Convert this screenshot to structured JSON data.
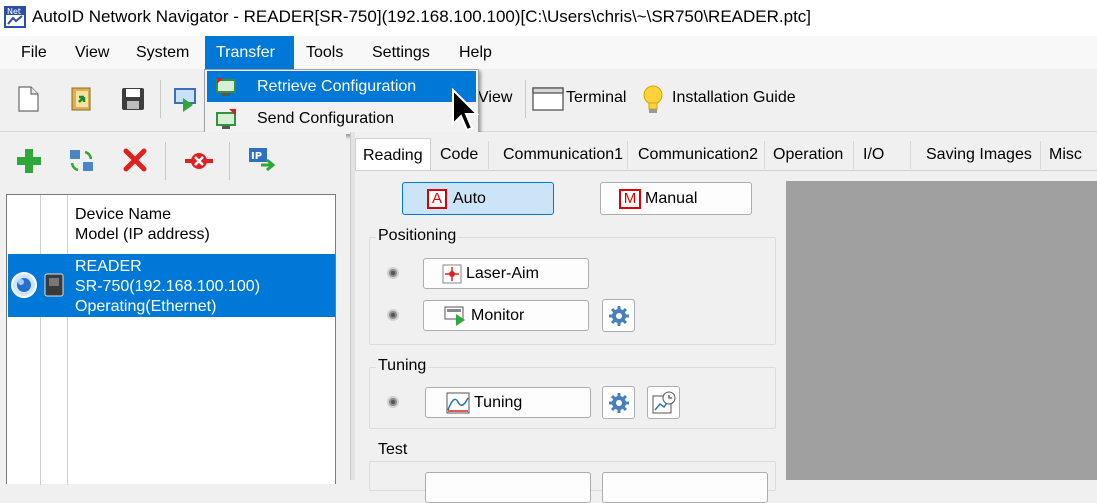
{
  "window": {
    "title": "AutoID Network Navigator - READER[SR-750](192.168.100.100)[C:\\Users\\chris\\~\\SR750\\READER.ptc]",
    "app_icon": "net-app-icon"
  },
  "menubar": {
    "items": [
      {
        "label": "File"
      },
      {
        "label": "View"
      },
      {
        "label": "System"
      },
      {
        "label": "Transfer"
      },
      {
        "label": "Tools"
      },
      {
        "label": "Settings"
      },
      {
        "label": "Help"
      }
    ],
    "active": "Transfer"
  },
  "transfer_menu": {
    "items": [
      {
        "label": "Retrieve Configuration",
        "icon": "retrieve-config-icon",
        "highlighted": true
      },
      {
        "label": "Send Configuration",
        "icon": "send-config-icon",
        "highlighted": false
      }
    ]
  },
  "toolbar": {
    "view_label": "View",
    "terminal_label": "Terminal",
    "installation_guide_label": "Installation Guide",
    "icons": [
      "new-file-icon",
      "open-file-icon",
      "save-icon",
      "monitor-play-icon",
      "view-icon",
      "terminal-icon",
      "lightbulb-icon"
    ]
  },
  "left_toolbar": {
    "icons": [
      "add-device-icon",
      "refresh-devices-icon",
      "delete-device-icon",
      "disconnect-icon",
      "ip-setting-icon"
    ]
  },
  "device_list": {
    "header_line1": "Device Name",
    "header_line2": "Model (IP address)",
    "rows": [
      {
        "name": "READER",
        "model_ip": "SR-750(192.168.100.100)",
        "status": "Operating(Ethernet)",
        "selected": true
      }
    ]
  },
  "tabs": {
    "items": [
      {
        "label": "Reading"
      },
      {
        "label": "Code"
      },
      {
        "label": "Communication1"
      },
      {
        "label": "Communication2"
      },
      {
        "label": "Operation"
      },
      {
        "label": "I/O"
      },
      {
        "label": "Saving Images"
      },
      {
        "label": "Misc"
      }
    ],
    "selected": "Reading"
  },
  "reading": {
    "auto_letter": "A",
    "auto_label": "Auto",
    "manual_letter": "M",
    "manual_label": "Manual",
    "mode_selected": "Auto",
    "positioning_title": "Positioning",
    "laser_aim_label": "Laser-Aim",
    "monitor_label": "Monitor",
    "tuning_title": "Tuning",
    "tuning_label": "Tuning",
    "test_title": "Test"
  },
  "colors": {
    "selection": "#0078d7",
    "menu_bg": "#f2f2f2",
    "image_area": "#a0a0a0",
    "auto_red": "#e00000"
  }
}
